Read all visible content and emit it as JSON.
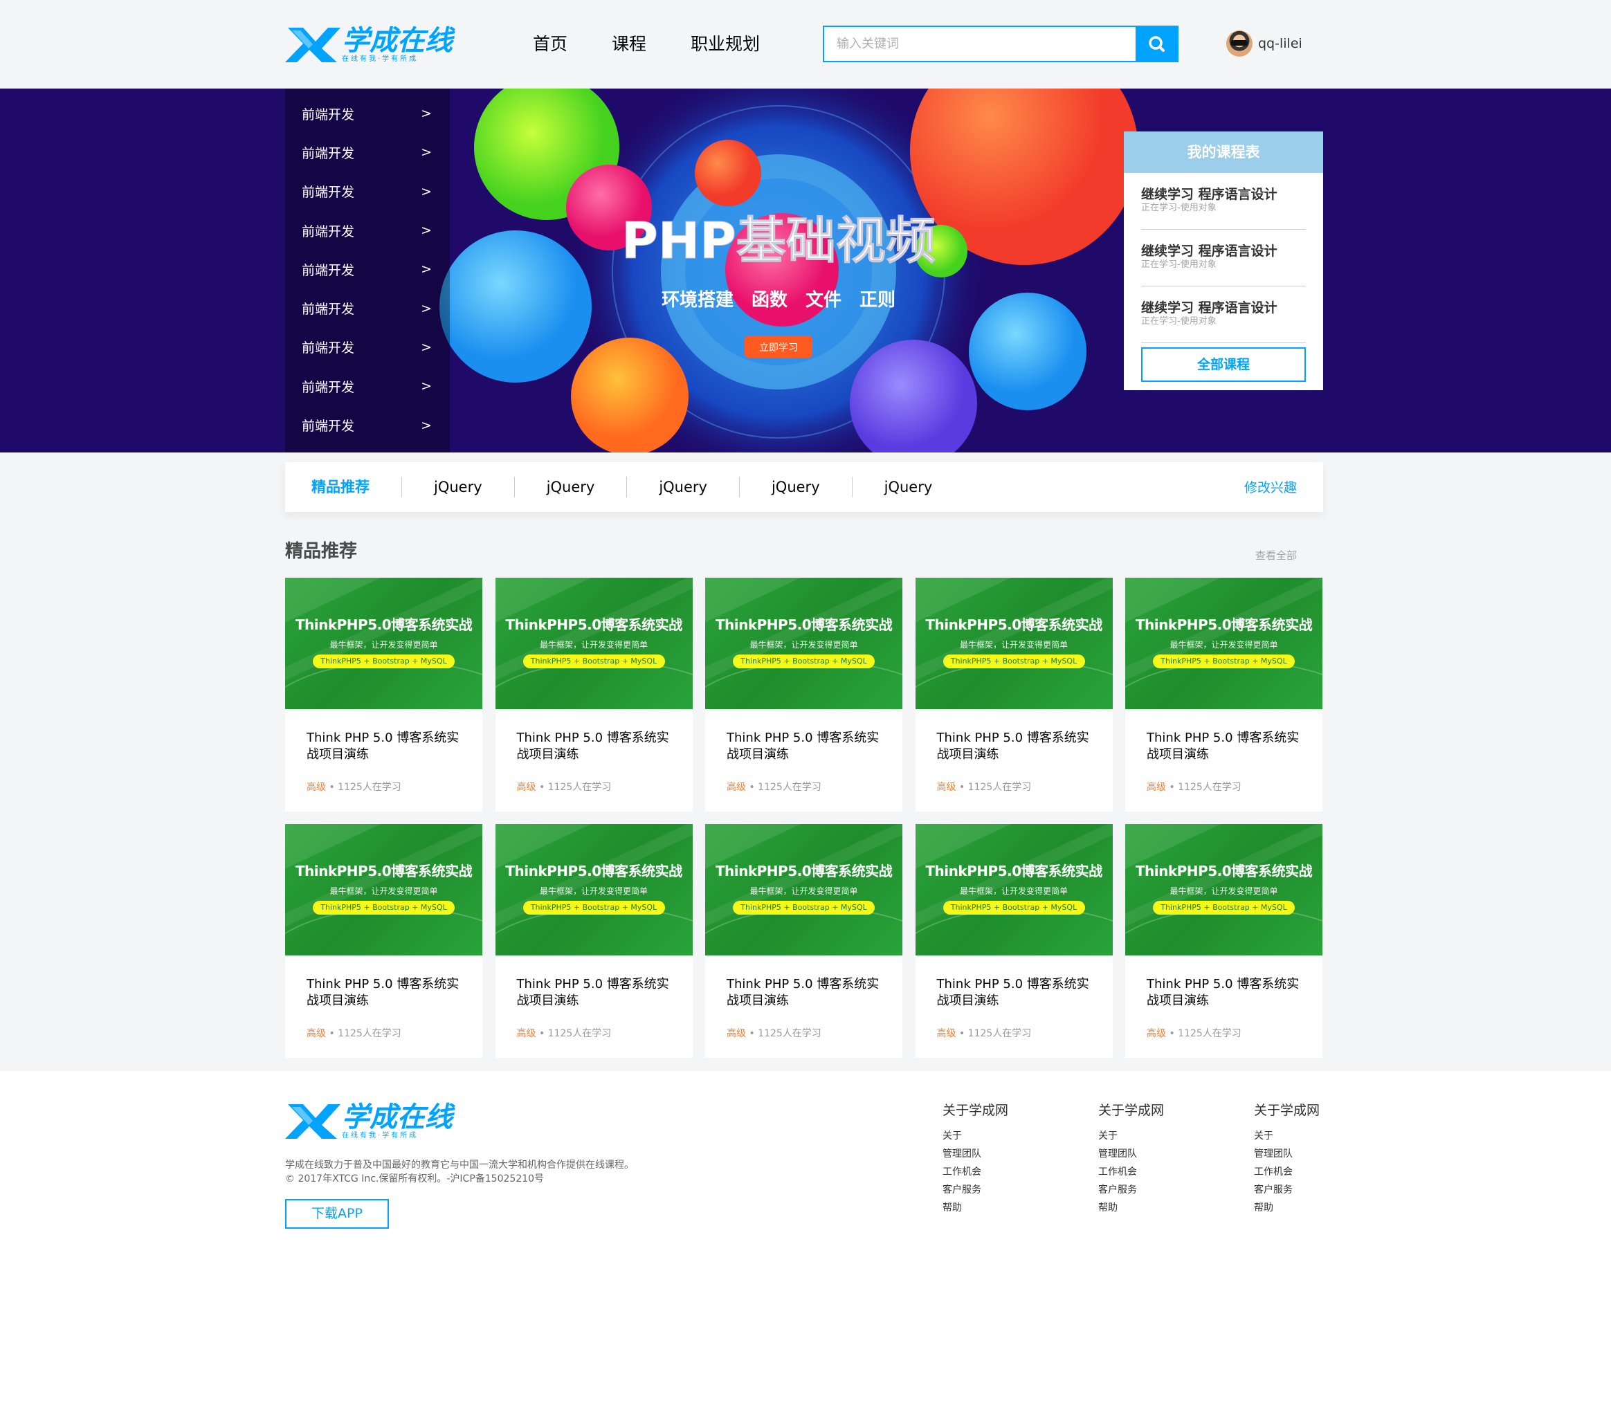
{
  "header": {
    "logo_text": "学成在线",
    "logo_slogan": "在线有我·学有所成",
    "nav": [
      "首页",
      "课程",
      "职业规划"
    ],
    "search_placeholder": "输入关键词",
    "username": "qq-lilei"
  },
  "banner": {
    "subnav_items": [
      {
        "label": "前端开发",
        "arrow": ">"
      },
      {
        "label": "前端开发",
        "arrow": ">"
      },
      {
        "label": "前端开发",
        "arrow": ">"
      },
      {
        "label": "前端开发",
        "arrow": ">"
      },
      {
        "label": "前端开发",
        "arrow": ">"
      },
      {
        "label": "前端开发",
        "arrow": ">"
      },
      {
        "label": "前端开发",
        "arrow": ">"
      },
      {
        "label": "前端开发",
        "arrow": ">"
      },
      {
        "label": "前端开发",
        "arrow": ">"
      }
    ],
    "title": "PHP基础视频",
    "subtitle": "环境搭建　函数　文件　正则",
    "cta": "立即学习"
  },
  "course_table": {
    "title": "我的课程表",
    "items": [
      {
        "title": "继续学习 程序语言设计",
        "sub": "正在学习-使用对象"
      },
      {
        "title": "继续学习 程序语言设计",
        "sub": "正在学习-使用对象"
      },
      {
        "title": "继续学习 程序语言设计",
        "sub": "正在学习-使用对象"
      }
    ],
    "all_button": "全部课程"
  },
  "track": {
    "items": [
      "精品推荐",
      "jQuery",
      "jQuery",
      "jQuery",
      "jQuery",
      "jQuery"
    ],
    "modify": "修改兴趣"
  },
  "goods": {
    "title": "精品推荐",
    "view_all": "查看全部",
    "thumb_title": "ThinkPHP5.0博客系统实战",
    "thumb_sub": "最牛框架，让开发变得更简单",
    "thumb_tag": "ThinkPHP5 + Bootstrap + MySQL",
    "cards": [
      {
        "name": "Think PHP 5.0 博客系统实战项目演练",
        "level": "高级",
        "learners": " • 1125人在学习"
      },
      {
        "name": "Think PHP 5.0 博客系统实战项目演练",
        "level": "高级",
        "learners": " • 1125人在学习"
      },
      {
        "name": "Think PHP 5.0 博客系统实战项目演练",
        "level": "高级",
        "learners": " • 1125人在学习"
      },
      {
        "name": "Think PHP 5.0 博客系统实战项目演练",
        "level": "高级",
        "learners": " • 1125人在学习"
      },
      {
        "name": "Think PHP 5.0 博客系统实战项目演练",
        "level": "高级",
        "learners": " • 1125人在学习"
      },
      {
        "name": "Think PHP 5.0 博客系统实战项目演练",
        "level": "高级",
        "learners": " • 1125人在学习"
      },
      {
        "name": "Think PHP 5.0 博客系统实战项目演练",
        "level": "高级",
        "learners": " • 1125人在学习"
      },
      {
        "name": "Think PHP 5.0 博客系统实战项目演练",
        "level": "高级",
        "learners": " • 1125人在学习"
      },
      {
        "name": "Think PHP 5.0 博客系统实战项目演练",
        "level": "高级",
        "learners": " • 1125人在学习"
      },
      {
        "name": "Think PHP 5.0 博客系统实战项目演练",
        "level": "高级",
        "learners": " • 1125人在学习"
      }
    ]
  },
  "footer": {
    "desc_line1": "学成在线致力于普及中国最好的教育它与中国一流大学和机构合作提供在线课程。",
    "desc_line2": "© 2017年XTCG Inc.保留所有权利。-沪ICP备15025210号",
    "download": "下载APP",
    "columns": [
      {
        "title": "关于学成网",
        "links": [
          "关于",
          "管理团队",
          "工作机会",
          "客户服务",
          "帮助"
        ]
      },
      {
        "title": "关于学成网",
        "links": [
          "关于",
          "管理团队",
          "工作机会",
          "客户服务",
          "帮助"
        ]
      },
      {
        "title": "关于学成网",
        "links": [
          "关于",
          "管理团队",
          "工作机会",
          "客户服务",
          "帮助"
        ]
      }
    ]
  },
  "colors": {
    "accent": "#00a4ff",
    "banner_bg": "#1f0a6a",
    "course_table_header": "#9bceea",
    "level": "#ff7c2d",
    "cta": "#ff5a1f"
  },
  "icons": {
    "search": "search-icon",
    "subnav_arrow": "chevron-right-icon"
  }
}
